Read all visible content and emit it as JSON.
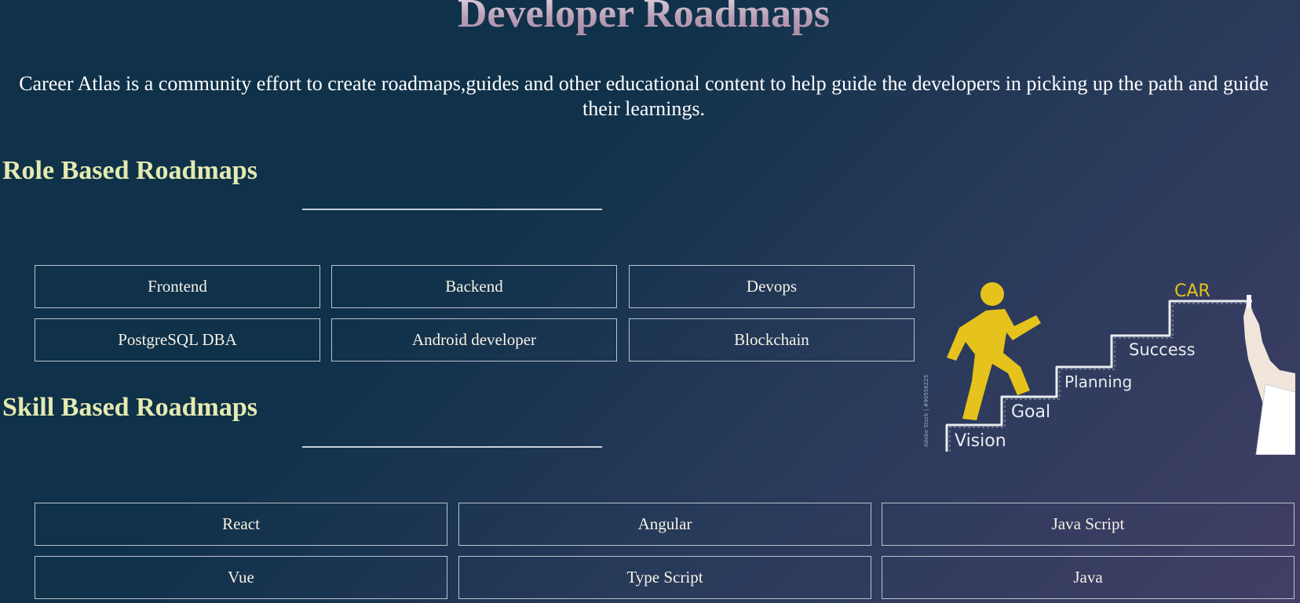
{
  "page": {
    "title": "Developer Roadmaps",
    "intro": "Career Atlas is a community effort to create roadmaps,guides and other educational content to help guide the developers in picking up the path and guide their learnings."
  },
  "role_section": {
    "heading": "Role Based Roadmaps",
    "buttons": [
      "Frontend",
      "Backend",
      "Devops",
      "PostgreSQL DBA",
      "Android developer",
      "Blockchain"
    ]
  },
  "skill_section": {
    "heading": "Skill Based Roadmaps",
    "buttons": [
      "React",
      "Angular",
      "Java Script",
      "Vue",
      "Type Script",
      "Java"
    ]
  },
  "illustration": {
    "steps": [
      "Vision",
      "Goal",
      "Planning",
      "Success",
      "CAR"
    ],
    "watermark": "Adobe Stock | #90556225",
    "colors": {
      "figure": "#e6c31c",
      "chalk": "#e9ecef",
      "top_label": "#e6c31c"
    }
  }
}
